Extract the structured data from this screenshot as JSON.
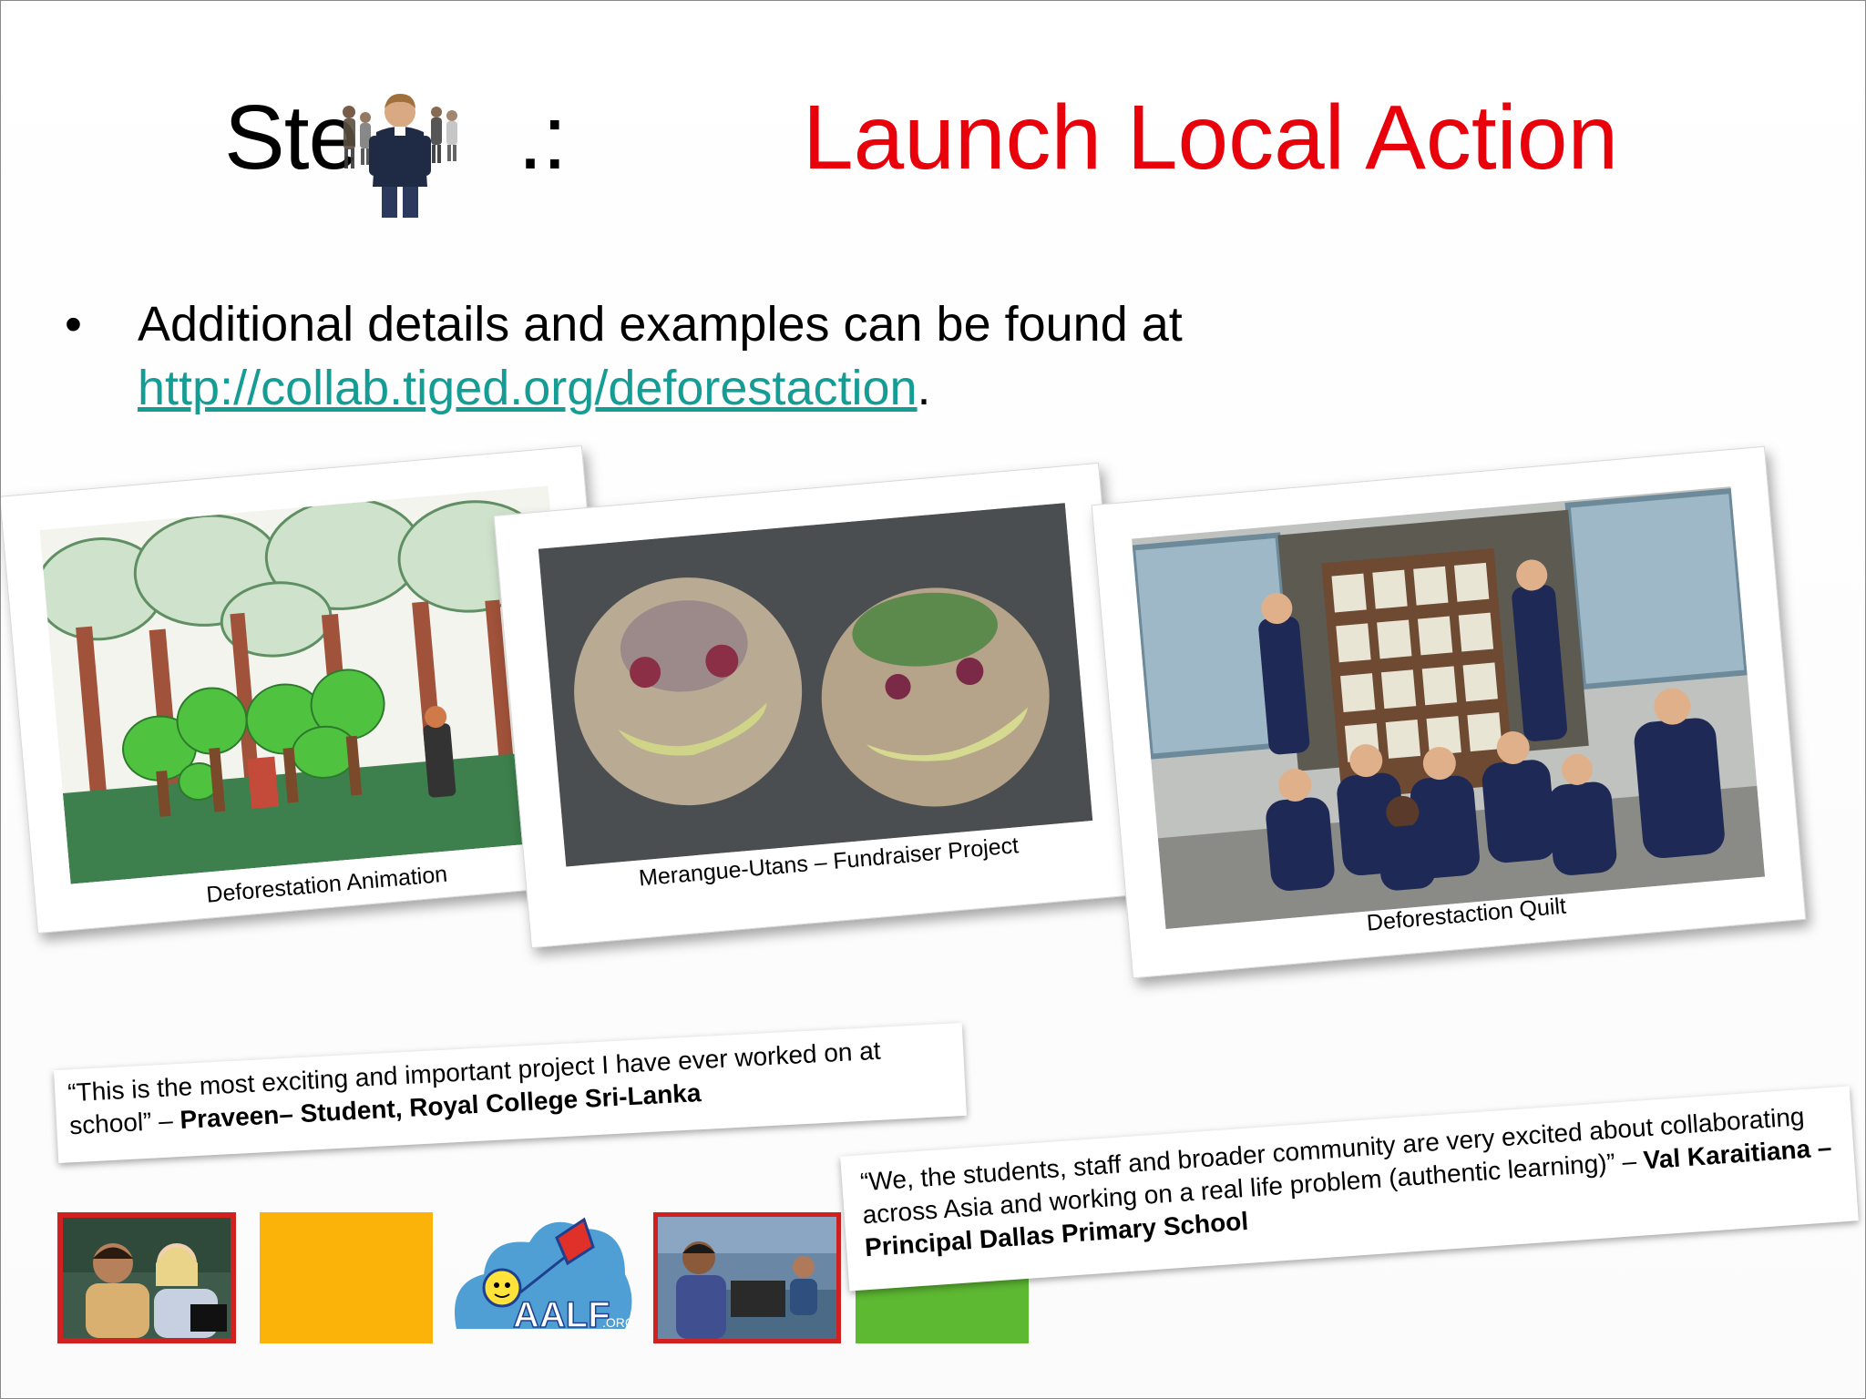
{
  "title": {
    "left": "Ste",
    "left_suffix": ".:",
    "right": "Launch Local Action"
  },
  "bullet": {
    "symbol": "•",
    "text": "Additional details and examples  can be found at",
    "link": "http://collab.tiged.org/deforestaction",
    "after_link": "."
  },
  "photos": [
    {
      "caption": "Deforestation Animation"
    },
    {
      "caption": "Merangue-Utans – Fundraiser Project"
    },
    {
      "caption": "Deforestaction Quilt"
    }
  ],
  "quotes": [
    {
      "text": "“This is the most exciting and important project I have ever worked on at school” – ",
      "attribution": "Praveen– Student, Royal College Sri-Lanka"
    },
    {
      "text": "“We, the students, staff and broader community are very excited about collaborating across Asia and working on a real life problem (authentic learning)” – ",
      "attribution": "Val Karaitiana – Principal Dallas Primary School"
    }
  ],
  "logo": {
    "text": "AALF",
    "suffix": ".ORG"
  },
  "colors": {
    "title_accent": "#e8000b",
    "link": "#159c94",
    "tile_yellow": "#fbb30a",
    "tile_green": "#5db832",
    "tile_border_red": "#d02020"
  }
}
